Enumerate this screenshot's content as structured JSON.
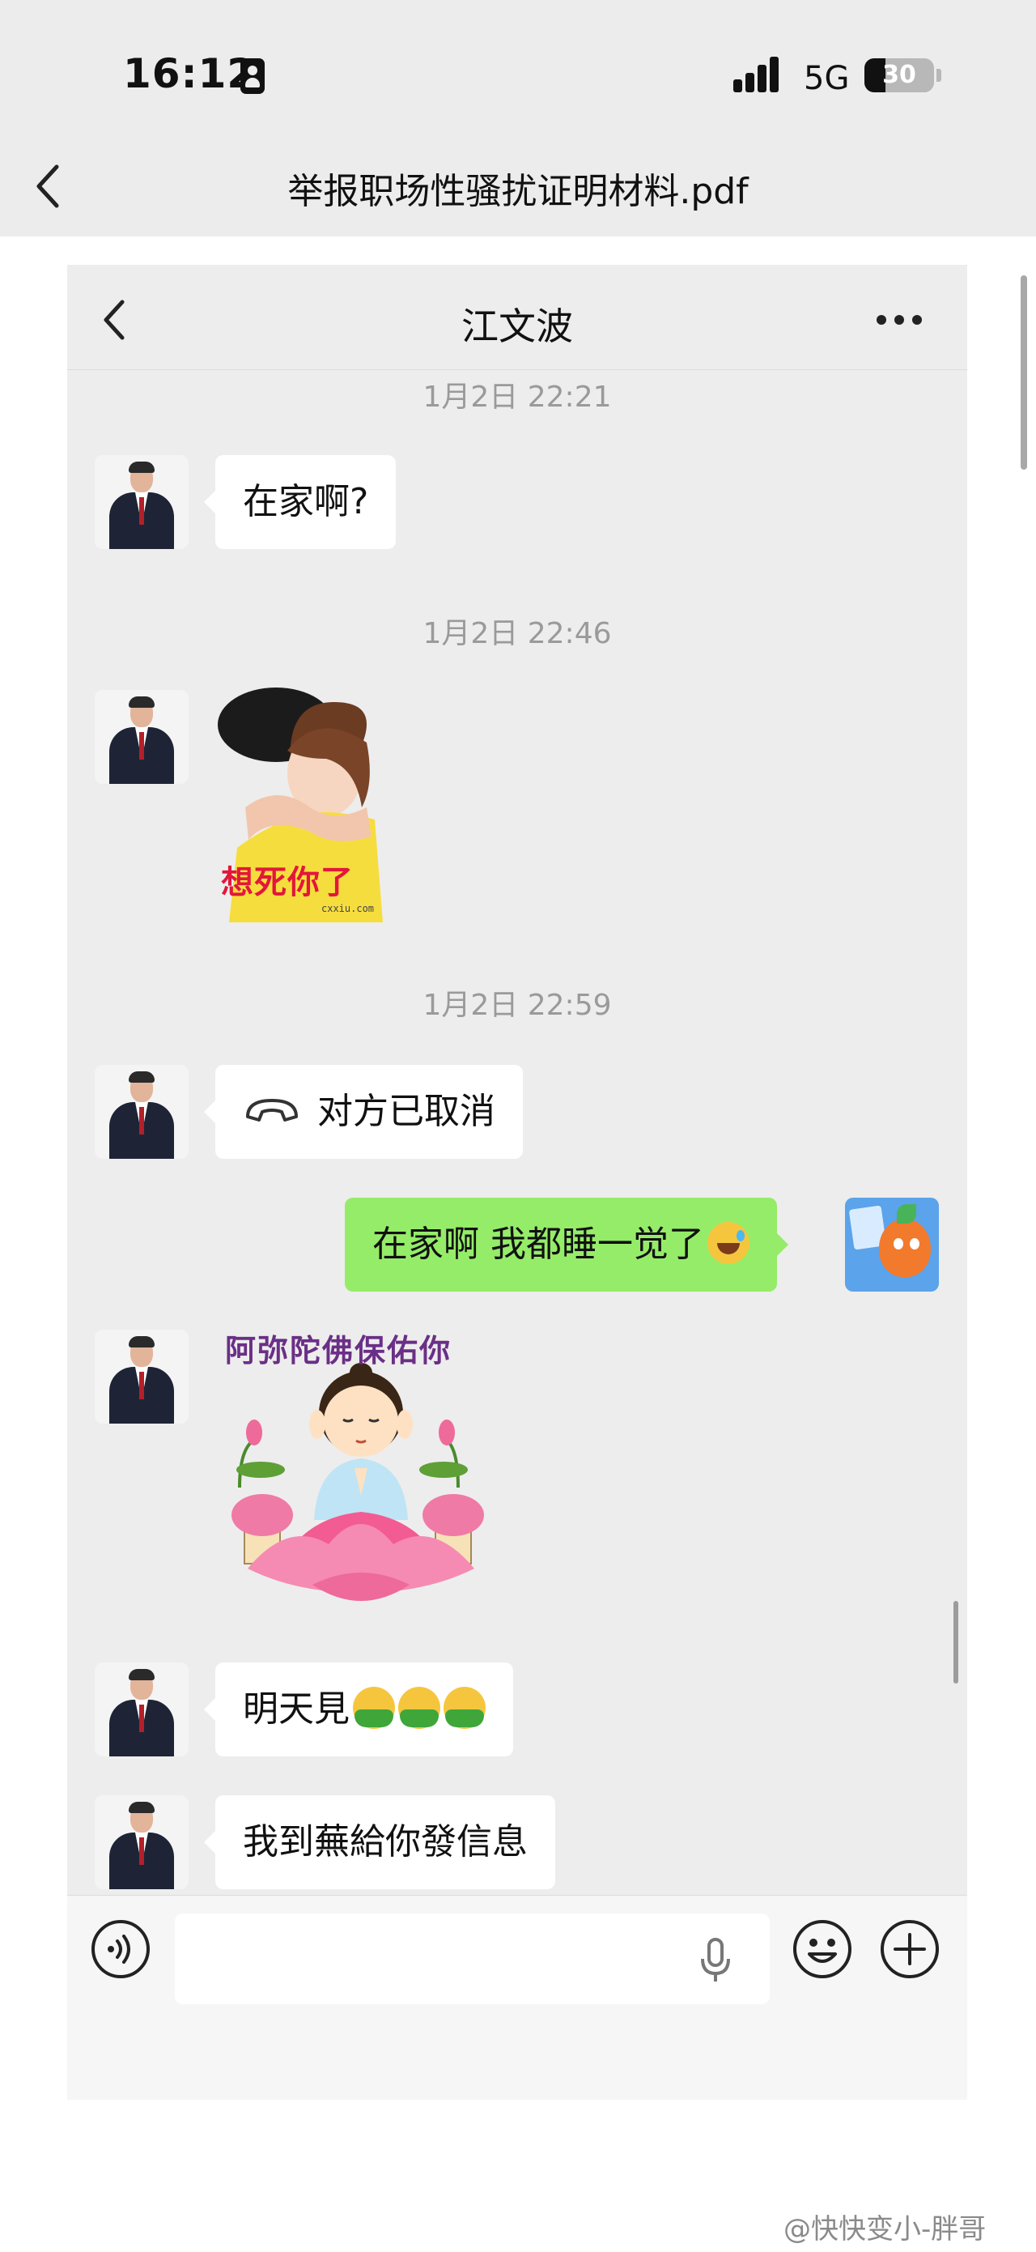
{
  "status_bar": {
    "time": "16:12",
    "network": "5G",
    "battery": "30",
    "battery_level_percent": 30
  },
  "document": {
    "title": "举报职场性骚扰证明材料.pdf"
  },
  "chat": {
    "contact_name": "江文波",
    "timestamps": [
      "1月2日 22:21",
      "1月2日 22:46",
      "1月2日 22:59"
    ],
    "messages": {
      "m1": "在家啊?",
      "sticker1_caption": "想死你了",
      "sticker1_watermark": "cxxiu.com",
      "call_status": "对方已取消",
      "m_self": "在家啊 我都睡一觉了",
      "sticker2_caption": "阿弥陀佛保佑你",
      "m3": "明天見",
      "m4": "我到蕪給你發信息"
    },
    "input": {
      "value": "",
      "placeholder": ""
    }
  },
  "icons": {
    "doc_back": "chevron-left-icon",
    "chat_back": "chevron-left-icon",
    "more": "more-dots-icon",
    "call": "phone-hangup-icon",
    "voice": "voice-input-icon",
    "mic": "microphone-icon",
    "emoji": "smile-icon",
    "plus": "plus-icon"
  },
  "colors": {
    "self_bubble": "#95ec69",
    "other_bubble": "#ffffff",
    "chat_background": "#ededed"
  },
  "watermark": "@快快变小-胖哥"
}
